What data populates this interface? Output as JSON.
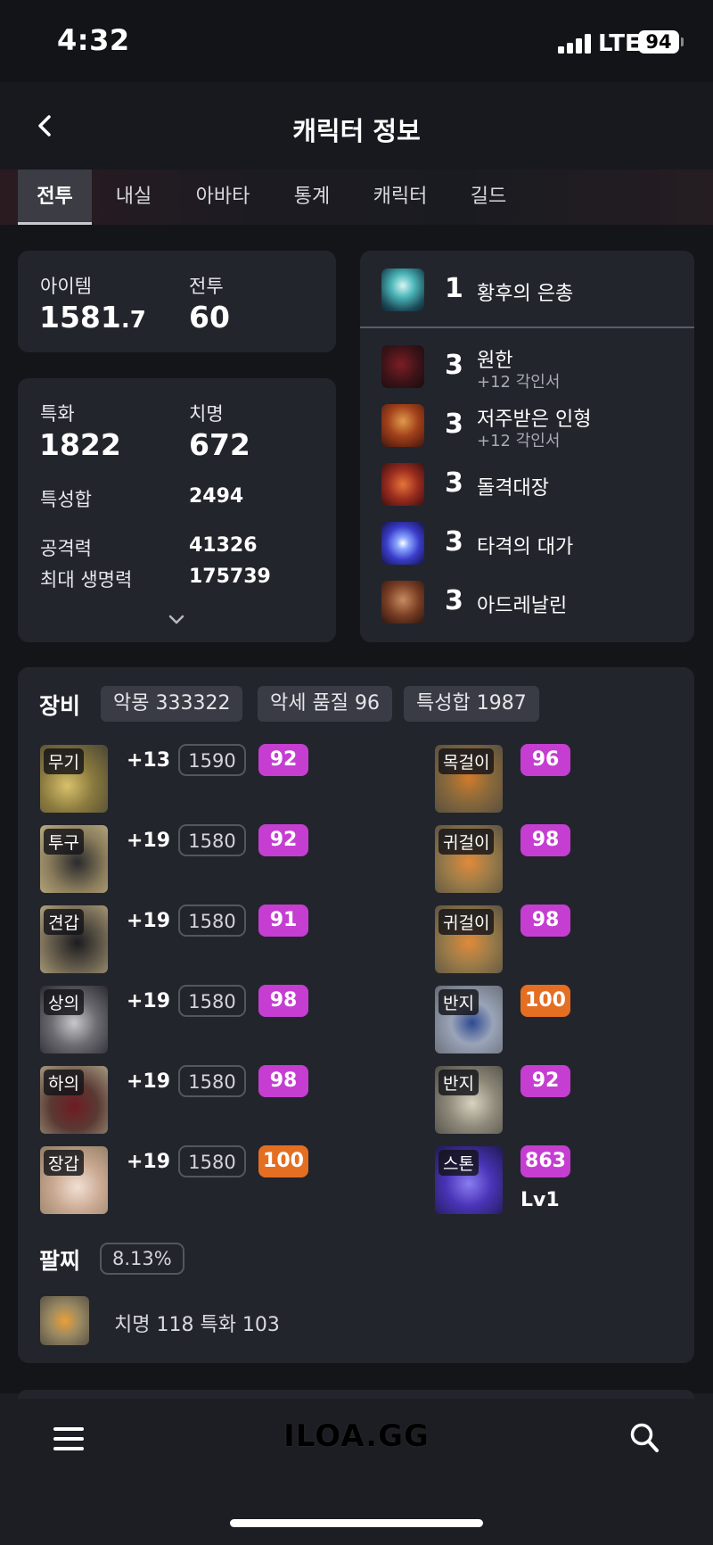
{
  "status": {
    "time": "4:32",
    "network": "LTE",
    "battery": "94"
  },
  "header": {
    "title": "캐릭터 정보"
  },
  "tabs": [
    "전투",
    "내실",
    "아바타",
    "통계",
    "캐릭터",
    "길드"
  ],
  "stats": {
    "item_label": "아이템",
    "item_value": "1581",
    "item_decimal": ".7",
    "combat_label": "전투",
    "combat_value": "60",
    "spec_label": "특화",
    "spec_value": "1822",
    "crit_label": "치명",
    "crit_value": "672",
    "stat_sum_label": "특성합",
    "stat_sum_value": "2494",
    "attack_label": "공격력",
    "attack_value": "41326",
    "hp_label": "최대 생명력",
    "hp_value": "175739"
  },
  "engravings": [
    {
      "level": "1",
      "name": "황후의 은총",
      "sub": "",
      "icon": "empress-grace-icon"
    },
    {
      "level": "3",
      "name": "원한",
      "sub": "+12 각인서",
      "icon": "grudge-icon"
    },
    {
      "level": "3",
      "name": "저주받은 인형",
      "sub": "+12 각인서",
      "icon": "cursed-doll-icon"
    },
    {
      "level": "3",
      "name": "돌격대장",
      "sub": "",
      "icon": "raid-captain-icon"
    },
    {
      "level": "3",
      "name": "타격의 대가",
      "sub": "",
      "icon": "hit-master-icon"
    },
    {
      "level": "3",
      "name": "아드레날린",
      "sub": "",
      "icon": "adrenaline-icon"
    }
  ],
  "equipment": {
    "title": "장비",
    "chips": [
      "악몽 333322",
      "악세 품질 96",
      "특성합 1987"
    ],
    "left": [
      {
        "slot": "무기",
        "plus": "+13",
        "ilvl": "1590",
        "quality": "92",
        "quality_color": "#c53ed1"
      },
      {
        "slot": "투구",
        "plus": "+19",
        "ilvl": "1580",
        "quality": "92",
        "quality_color": "#c53ed1"
      },
      {
        "slot": "견갑",
        "plus": "+19",
        "ilvl": "1580",
        "quality": "91",
        "quality_color": "#c53ed1"
      },
      {
        "slot": "상의",
        "plus": "+19",
        "ilvl": "1580",
        "quality": "98",
        "quality_color": "#c53ed1"
      },
      {
        "slot": "하의",
        "plus": "+19",
        "ilvl": "1580",
        "quality": "98",
        "quality_color": "#c53ed1"
      },
      {
        "slot": "장갑",
        "plus": "+19",
        "ilvl": "1580",
        "quality": "100",
        "quality_color": "#e46e22"
      }
    ],
    "right": [
      {
        "slot": "목걸이",
        "quality": "96",
        "quality_color": "#c53ed1"
      },
      {
        "slot": "귀걸이",
        "quality": "98",
        "quality_color": "#c53ed1"
      },
      {
        "slot": "귀걸이",
        "quality": "98",
        "quality_color": "#c53ed1"
      },
      {
        "slot": "반지",
        "quality": "100",
        "quality_color": "#e46e22"
      },
      {
        "slot": "반지",
        "quality": "92",
        "quality_color": "#c53ed1"
      },
      {
        "slot": "스톤",
        "quality": "863",
        "quality_color": "#c53ed1",
        "sub": "Lv1"
      }
    ]
  },
  "bracelet": {
    "title": "팔찌",
    "percent": "8.13%",
    "stats": "치명 118  특화 103"
  },
  "footer": {
    "brand": "ILOA.GG"
  }
}
